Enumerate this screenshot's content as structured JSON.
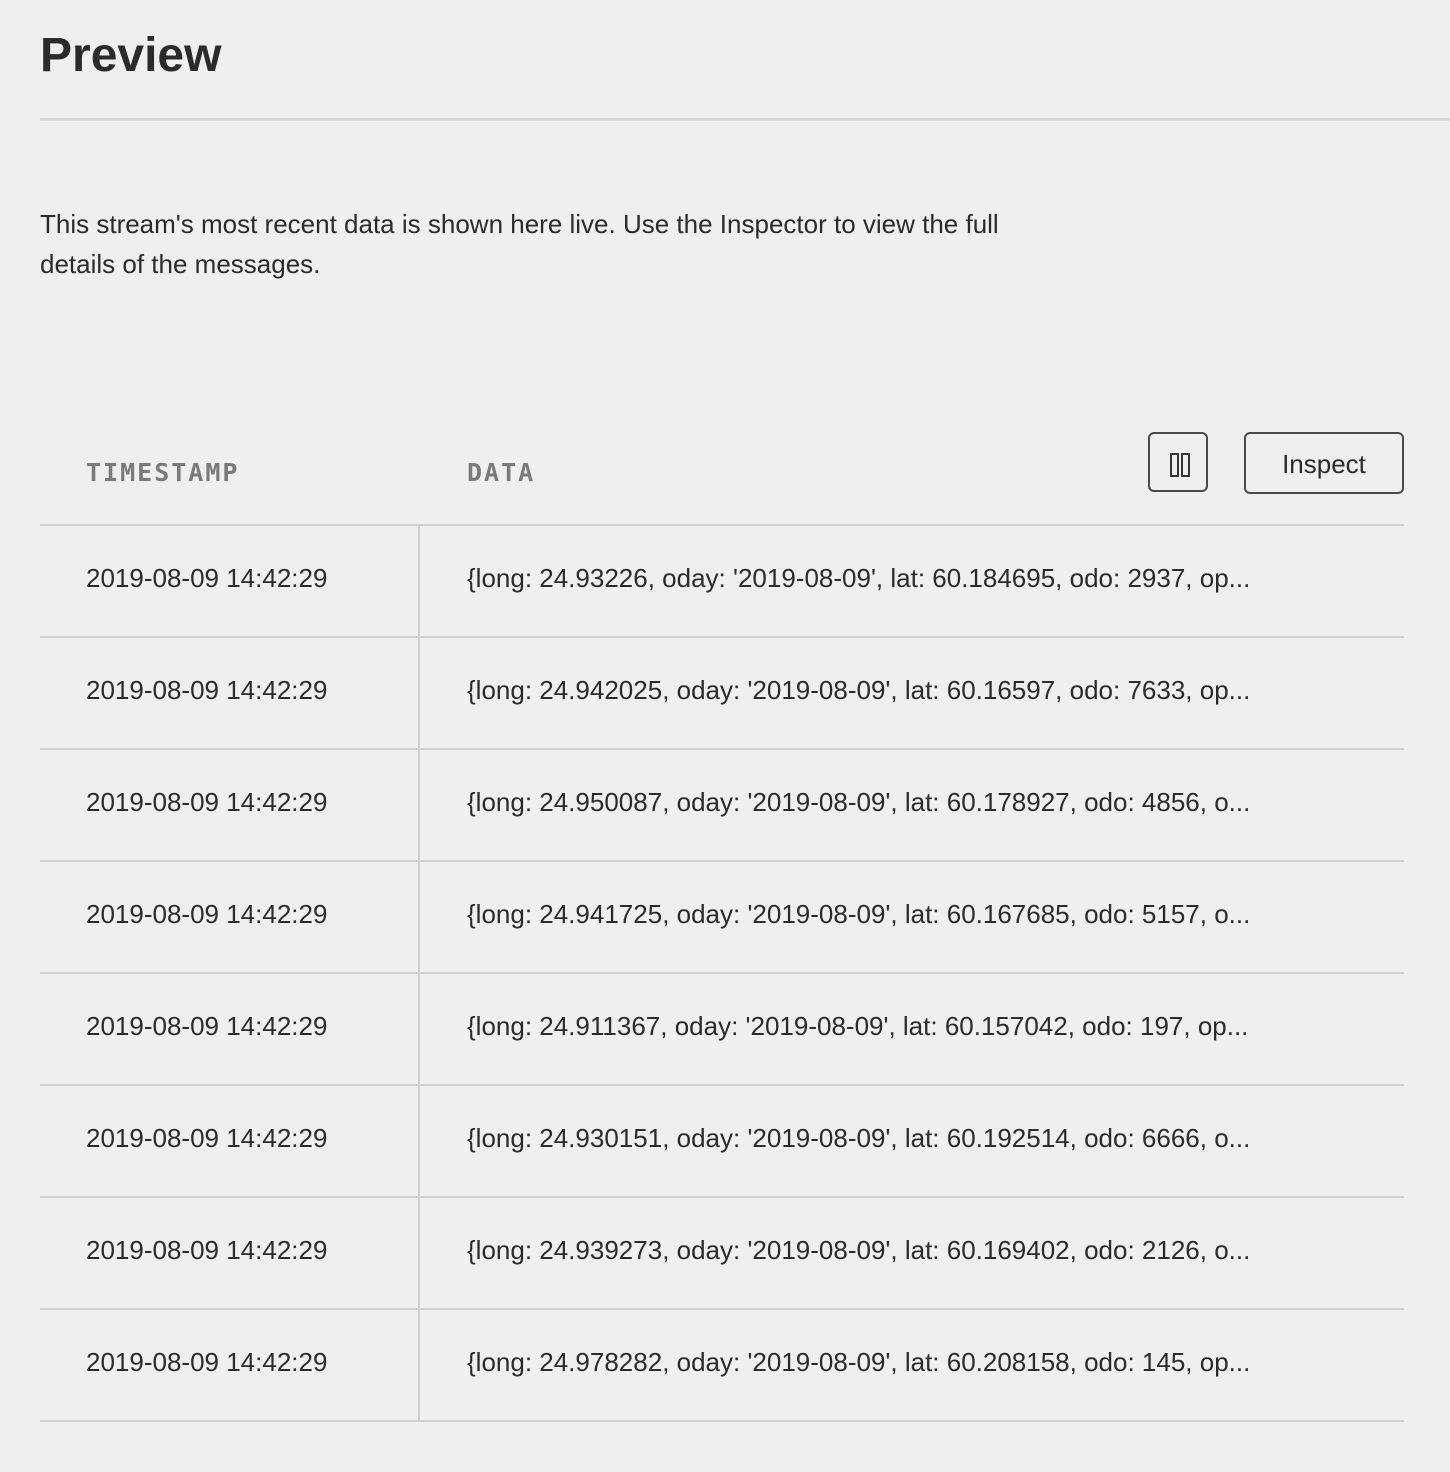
{
  "page": {
    "title": "Preview",
    "description": "This stream's most recent data is shown here live. Use the Inspector to view the full details of the messages."
  },
  "table": {
    "columns": {
      "timestamp": "TIMESTAMP",
      "data": "DATA"
    },
    "actions": {
      "pause_icon": "pause-icon",
      "inspect_label": "Inspect"
    },
    "rows": [
      {
        "timestamp": "2019-08-09 14:42:29",
        "data": "{long: 24.93226, oday: '2019-08-09', lat: 60.184695, odo: 2937, op..."
      },
      {
        "timestamp": "2019-08-09 14:42:29",
        "data": "{long: 24.942025, oday: '2019-08-09', lat: 60.16597, odo: 7633, op..."
      },
      {
        "timestamp": "2019-08-09 14:42:29",
        "data": "{long: 24.950087, oday: '2019-08-09', lat: 60.178927, odo: 4856, o..."
      },
      {
        "timestamp": "2019-08-09 14:42:29",
        "data": "{long: 24.941725, oday: '2019-08-09', lat: 60.167685, odo: 5157, o..."
      },
      {
        "timestamp": "2019-08-09 14:42:29",
        "data": "{long: 24.911367, oday: '2019-08-09', lat: 60.157042, odo: 197, op..."
      },
      {
        "timestamp": "2019-08-09 14:42:29",
        "data": "{long: 24.930151, oday: '2019-08-09', lat: 60.192514, odo: 6666, o..."
      },
      {
        "timestamp": "2019-08-09 14:42:29",
        "data": "{long: 24.939273, oday: '2019-08-09', lat: 60.169402, odo: 2126, o..."
      },
      {
        "timestamp": "2019-08-09 14:42:29",
        "data": "{long: 24.978282, oday: '2019-08-09', lat: 60.208158, odo: 145, op..."
      }
    ]
  },
  "colors": {
    "background": "#efefef",
    "text": "#2b2b2b",
    "header_text": "#7a7a7a",
    "divider": "#cfcfcf"
  }
}
